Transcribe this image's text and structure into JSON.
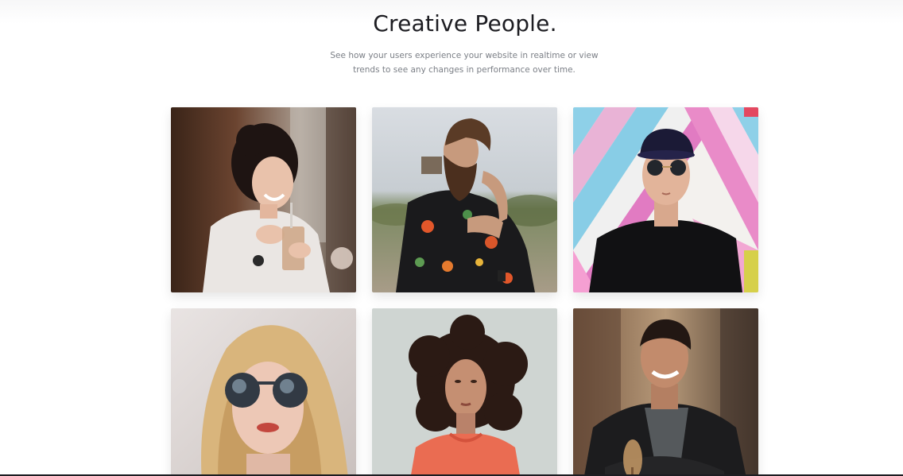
{
  "section": {
    "title": "Creative People.",
    "subtitle_line1": "See how your users experience your website in realtime or view",
    "subtitle_line2": "trends to see any changes in performance over time."
  },
  "people": [
    {
      "name": "person-photo-woman-coffee"
    },
    {
      "name": "person-photo-bearded-man"
    },
    {
      "name": "person-photo-man-sunglasses-cap"
    },
    {
      "name": "person-photo-blonde-woman-sunglasses"
    },
    {
      "name": "person-photo-curly-hair-woman"
    },
    {
      "name": "person-photo-smiling-man-jacket"
    }
  ],
  "colors": {
    "title": "#1d1d22",
    "subtitle": "#7b7f86",
    "background": "#ffffff"
  }
}
